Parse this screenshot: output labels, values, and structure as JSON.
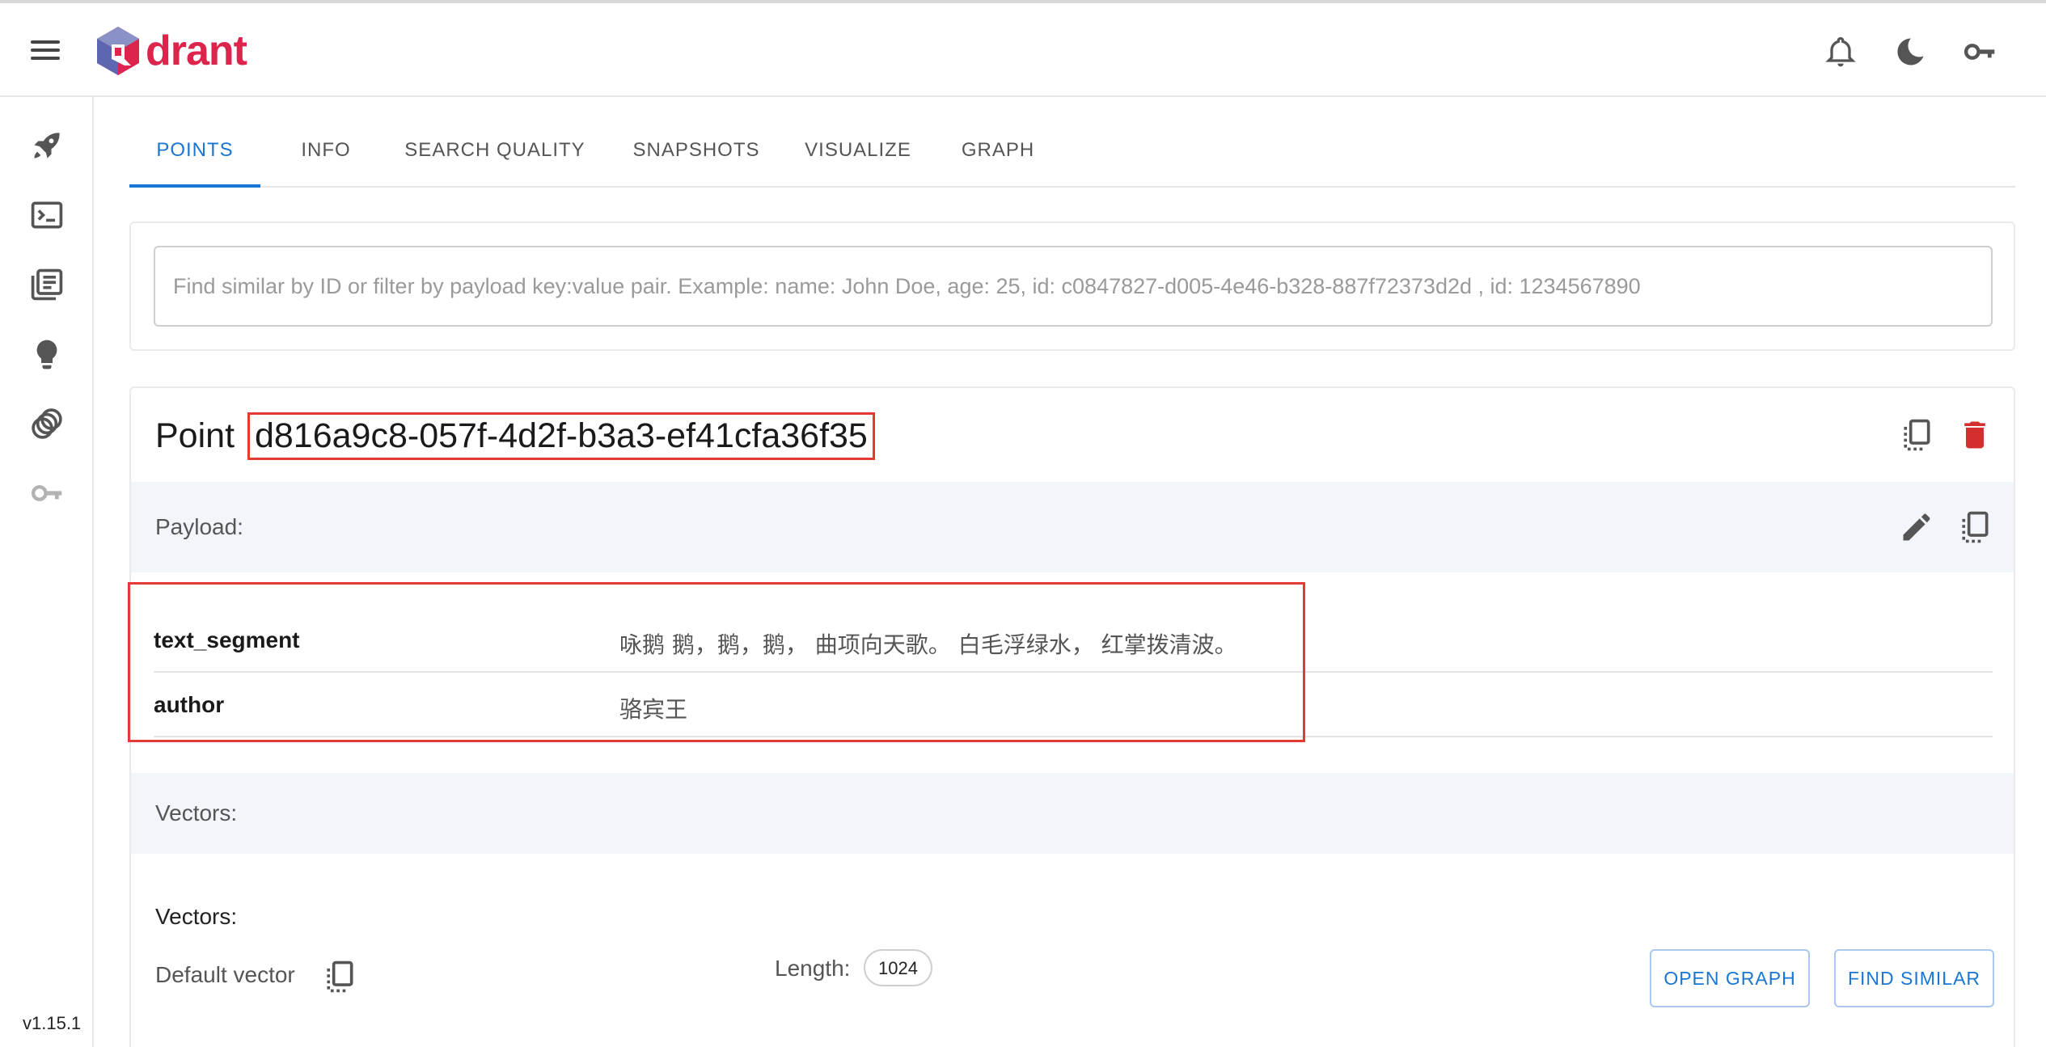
{
  "app": {
    "logo_text": "drant",
    "version": "v1.15.1"
  },
  "header": {
    "icons": [
      "bell-icon",
      "moon-icon",
      "key-icon"
    ]
  },
  "sidebar": {
    "icons": [
      "rocket-icon",
      "console-icon",
      "collections-icon",
      "lightbulb-icon",
      "datasets-icon",
      "access-key-icon"
    ]
  },
  "tabs": [
    {
      "label": "POINTS",
      "active": true
    },
    {
      "label": "INFO",
      "active": false
    },
    {
      "label": "SEARCH QUALITY",
      "active": false
    },
    {
      "label": "SNAPSHOTS",
      "active": false
    },
    {
      "label": "VISUALIZE",
      "active": false
    },
    {
      "label": "GRAPH",
      "active": false
    }
  ],
  "search": {
    "value": "",
    "placeholder": "Find similar by ID or filter by payload key:value pair. Example: name: John Doe, age: 25, id: c0847827-d005-4e46-b328-887f72373d2d , id: 1234567890"
  },
  "point": {
    "label": "Point",
    "id": "d816a9c8-057f-4d2f-b3a3-ef41cfa36f35",
    "payload_label": "Payload:",
    "payload": [
      {
        "key": "text_segment",
        "value": "咏鹅 鹅，鹅，鹅， 曲项向天歌。 白毛浮绿水， 红掌拨清波。"
      },
      {
        "key": "author",
        "value": "骆宾王"
      }
    ],
    "vectors_section_label": "Vectors:",
    "vectors_title": "Vectors:",
    "vector": {
      "name": "Default vector",
      "length_label": "Length:",
      "length": "1024"
    },
    "buttons": {
      "open_graph": "OPEN GRAPH",
      "find_similar": "FIND SIMILAR"
    }
  },
  "colors": {
    "accent": "#1976d2",
    "brand": "#dc244c",
    "danger": "#d32f2f",
    "highlight": "#e53935"
  }
}
